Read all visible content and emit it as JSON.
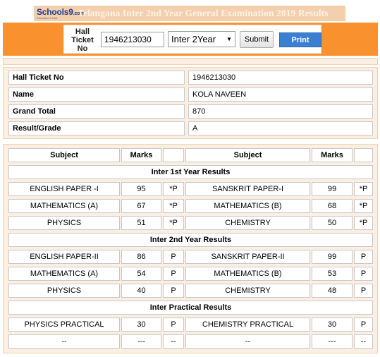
{
  "banner": {
    "logo_text": "Schools9",
    "logo_suffix": ".com",
    "logo_tagline": "Education Portal",
    "title": "Telangana Inter 2nd Year General Examination 2019 Results"
  },
  "form": {
    "hall_ticket_label": "Hall Ticket No",
    "hall_ticket_value": "1946213030",
    "year_selected": "Inter 2Year",
    "submit_label": "Submit",
    "print_label": "Print"
  },
  "info": [
    {
      "label": "Hall Ticket No",
      "value": "1946213030"
    },
    {
      "label": "Name",
      "value": "KOLA NAVEEN"
    },
    {
      "label": "Grand Total",
      "value": "870"
    },
    {
      "label": "Result/Grade",
      "value": "A"
    }
  ],
  "marks": {
    "headers": {
      "subject": "Subject",
      "marks": "Marks",
      "grade": ""
    },
    "sections": [
      {
        "title": "Inter 1st Year Results",
        "rows": [
          {
            "s1": "ENGLISH PAPER -I",
            "m1": "95",
            "g1": "*P",
            "s2": "SANSKRIT PAPER-I",
            "m2": "99",
            "g2": "*P"
          },
          {
            "s1": "MATHEMATICS (A)",
            "m1": "67",
            "g1": "*P",
            "s2": "MATHEMATICS (B)",
            "m2": "68",
            "g2": "*P"
          },
          {
            "s1": "PHYSICS",
            "m1": "51",
            "g1": "*P",
            "s2": "CHEMISTRY",
            "m2": "50",
            "g2": "*P"
          }
        ]
      },
      {
        "title": "Inter 2nd Year Results",
        "rows": [
          {
            "s1": "ENGLISH PAPER-II",
            "m1": "86",
            "g1": "P",
            "s2": "SANSKRIT PAPER-II",
            "m2": "99",
            "g2": "P"
          },
          {
            "s1": "MATHEMATICS (A)",
            "m1": "54",
            "g1": "P",
            "s2": "MATHEMATICS (B)",
            "m2": "53",
            "g2": "P"
          },
          {
            "s1": "PHYSICS",
            "m1": "40",
            "g1": "P",
            "s2": "CHEMISTRY",
            "m2": "48",
            "g2": "P"
          }
        ]
      },
      {
        "title": "Inter Practical Results",
        "rows": [
          {
            "s1": "PHYSICS PRACTICAL",
            "m1": "30",
            "g1": "P",
            "s2": "CHEMISTRY PRACTICAL",
            "m2": "30",
            "g2": "P"
          },
          {
            "s1": "--",
            "m1": "---",
            "g1": "--",
            "s2": "--",
            "m2": "---",
            "g2": "--"
          }
        ]
      }
    ]
  }
}
